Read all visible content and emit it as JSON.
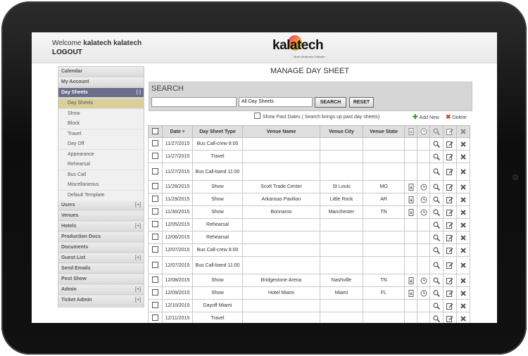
{
  "header": {
    "welcome_prefix": "Welcome",
    "username": "kalatech kalatech",
    "logout": "LOGOUT",
    "logo_text": "kalatech",
    "logo_tagline": "Music Business Software"
  },
  "sidebar": {
    "items": [
      {
        "label": "Calendar",
        "toggle": ""
      },
      {
        "label": "My Account",
        "toggle": ""
      },
      {
        "label": "Day Sheets",
        "toggle": "[-]"
      },
      {
        "label": "Users",
        "toggle": "[+]"
      },
      {
        "label": "Venues",
        "toggle": ""
      },
      {
        "label": "Hotels",
        "toggle": "[+]"
      },
      {
        "label": "Production Docs",
        "toggle": ""
      },
      {
        "label": "Documents",
        "toggle": ""
      },
      {
        "label": "Guest List",
        "toggle": "[+]"
      },
      {
        "label": "Send Emails",
        "toggle": ""
      },
      {
        "label": "Post Show",
        "toggle": ""
      },
      {
        "label": "Admin",
        "toggle": "[+]"
      },
      {
        "label": "Ticket Admin",
        "toggle": "[+]"
      }
    ],
    "sub_items": [
      "Day Sheets",
      "Show",
      "Block",
      "Travel",
      "Day Off",
      "Appearance",
      "Rehearsal",
      "Bus Call",
      "Miscellaneous",
      "Default Template"
    ]
  },
  "main": {
    "title": "MANAGE DAY SHEET",
    "search_label": "SEARCH",
    "search_placeholder": "",
    "filter_value": "All Day Sheets",
    "search_button": "SEARCH",
    "reset_button": "RESET",
    "show_past_label": "Show Past Dates",
    "show_past_note": "( Search brings up past day sheets)",
    "add_new": "Add New",
    "delete": "Delete"
  },
  "table": {
    "headers": [
      "Date",
      "Day Sheet Type",
      "Venue Name",
      "Venue City",
      "Venue State"
    ],
    "rows": [
      {
        "date": "11/27/2015",
        "type": "Bus Call-crew 8:00",
        "venue": "",
        "city": "",
        "state": "",
        "doc": false,
        "clock": false,
        "tall": false
      },
      {
        "date": "11/27/2015",
        "type": "Travel",
        "venue": "",
        "city": "",
        "state": "",
        "doc": false,
        "clock": false,
        "tall": false
      },
      {
        "date": "11/27/2015",
        "type": "Bus Call-band 11:00",
        "venue": "",
        "city": "",
        "state": "",
        "doc": false,
        "clock": false,
        "tall": true
      },
      {
        "date": "11/28/2015",
        "type": "Show",
        "venue": "Scott Trade Center",
        "city": "St Louis",
        "state": "MO",
        "doc": true,
        "clock": true,
        "tall": false
      },
      {
        "date": "11/29/2015",
        "type": "Show",
        "venue": "Arkansas Pavilion",
        "city": "Little Rock",
        "state": "AR",
        "doc": true,
        "clock": true,
        "tall": false
      },
      {
        "date": "11/30/2015",
        "type": "Show",
        "venue": "Bonnaroo",
        "city": "Manchester",
        "state": "TN",
        "doc": true,
        "clock": true,
        "tall": false
      },
      {
        "date": "12/05/2015",
        "type": "Rehearsal",
        "venue": "",
        "city": "",
        "state": "",
        "doc": false,
        "clock": false,
        "tall": false
      },
      {
        "date": "12/06/2015",
        "type": "Rehearsal",
        "venue": "",
        "city": "",
        "state": "",
        "doc": false,
        "clock": false,
        "tall": false
      },
      {
        "date": "12/07/2015",
        "type": "Bus Call-crew 8:00",
        "venue": "",
        "city": "",
        "state": "",
        "doc": false,
        "clock": false,
        "tall": false
      },
      {
        "date": "12/07/2015",
        "type": "Bus Call-band 11:00",
        "venue": "",
        "city": "",
        "state": "",
        "doc": false,
        "clock": false,
        "tall": true
      },
      {
        "date": "12/08/2015",
        "type": "Show",
        "venue": "Bridgestone Arena",
        "city": "Nashville",
        "state": "TN",
        "doc": true,
        "clock": true,
        "tall": false
      },
      {
        "date": "12/09/2015",
        "type": "Show",
        "venue": "Hotel Miami",
        "city": "Miami",
        "state": "FL",
        "doc": true,
        "clock": true,
        "tall": false
      },
      {
        "date": "12/10/2015",
        "type": "Dayoff Miami",
        "venue": "",
        "city": "",
        "state": "",
        "doc": false,
        "clock": false,
        "tall": false
      },
      {
        "date": "12/11/2015",
        "type": "Travel",
        "venue": "",
        "city": "",
        "state": "",
        "doc": false,
        "clock": false,
        "tall": false
      }
    ]
  }
}
